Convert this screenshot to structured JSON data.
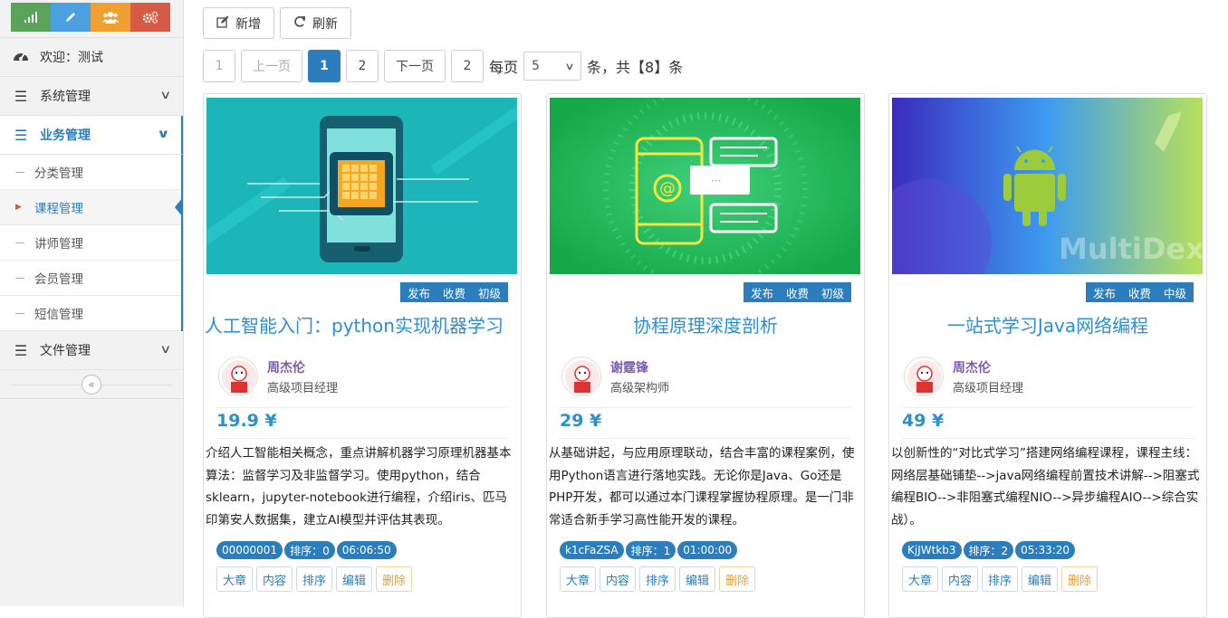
{
  "shortcuts": [
    {
      "icon": "signal-icon",
      "color": "#5aa45a"
    },
    {
      "icon": "pencil-icon",
      "color": "#4aa0e0"
    },
    {
      "icon": "users-icon",
      "color": "#f0a030"
    },
    {
      "icon": "cogs-icon",
      "color": "#d75a45"
    }
  ],
  "sidebar": {
    "welcome": "欢迎：测试",
    "system": "系统管理",
    "business": "业务管理",
    "sub": [
      "分类管理",
      "课程管理",
      "讲师管理",
      "会员管理",
      "短信管理"
    ],
    "files": "文件管理",
    "collapse": "«"
  },
  "toolbar": {
    "add": "新增",
    "refresh": "刷新"
  },
  "pager": {
    "first": "1",
    "prev": "上一页",
    "current": "1",
    "next_num": "2",
    "next": "下一页",
    "last": "2",
    "per_page": "每页",
    "size": "5",
    "total": "条，共【8】条"
  },
  "courses": [
    {
      "tags": [
        "发布",
        "收费",
        "初级"
      ],
      "title": "人工智能入门：python实现机器学习",
      "teacher": "周杰伦",
      "teacher_title": "高级项目经理",
      "price": "19.9 ¥",
      "desc": "介绍人工智能相关概念，重点讲解机器学习原理机器基本算法：监督学习及非监督学习。使用python，结合sklearn，jupyter-notebook进行编程，介绍iris、匹马印第安人数据集，建立AI模型并评估其表现。",
      "badges": [
        "00000001",
        "排序：0",
        "06:06:50"
      ],
      "actions": [
        "大章",
        "内容",
        "排序",
        "编辑",
        "删除"
      ]
    },
    {
      "tags": [
        "发布",
        "收费",
        "初级"
      ],
      "title": "协程原理深度剖析",
      "teacher": "谢霆锋",
      "teacher_title": "高级架构师",
      "price": "29 ¥",
      "desc": "从基础讲起，与应用原理联动，结合丰富的课程案例，使用Python语言进行落地实践。无论你是Java、Go还是PHP开发，都可以通过本门课程掌握协程原理。是一门非常适合新手学习高性能开发的课程。",
      "badges": [
        "k1cFaZSA",
        "排序：1",
        "01:00:00"
      ],
      "actions": [
        "大章",
        "内容",
        "排序",
        "编辑",
        "删除"
      ]
    },
    {
      "tags": [
        "发布",
        "收费",
        "中级"
      ],
      "title": "一站式学习Java网络编程",
      "teacher": "周杰伦",
      "teacher_title": "高级项目经理",
      "price": "49 ¥",
      "desc": "以创新性的“对比式学习”搭建网络编程课程，课程主线：网络层基础铺垫-->java网络编程前置技术讲解-->阻塞式编程BIO-->非阻塞式编程NIO-->异步编程AIO-->综合实战）。",
      "badges": [
        "KjJWtkb3",
        "排序：2",
        "05:33:20"
      ],
      "actions": [
        "大章",
        "内容",
        "排序",
        "编辑",
        "删除"
      ],
      "image_text": "MultiDex"
    }
  ]
}
